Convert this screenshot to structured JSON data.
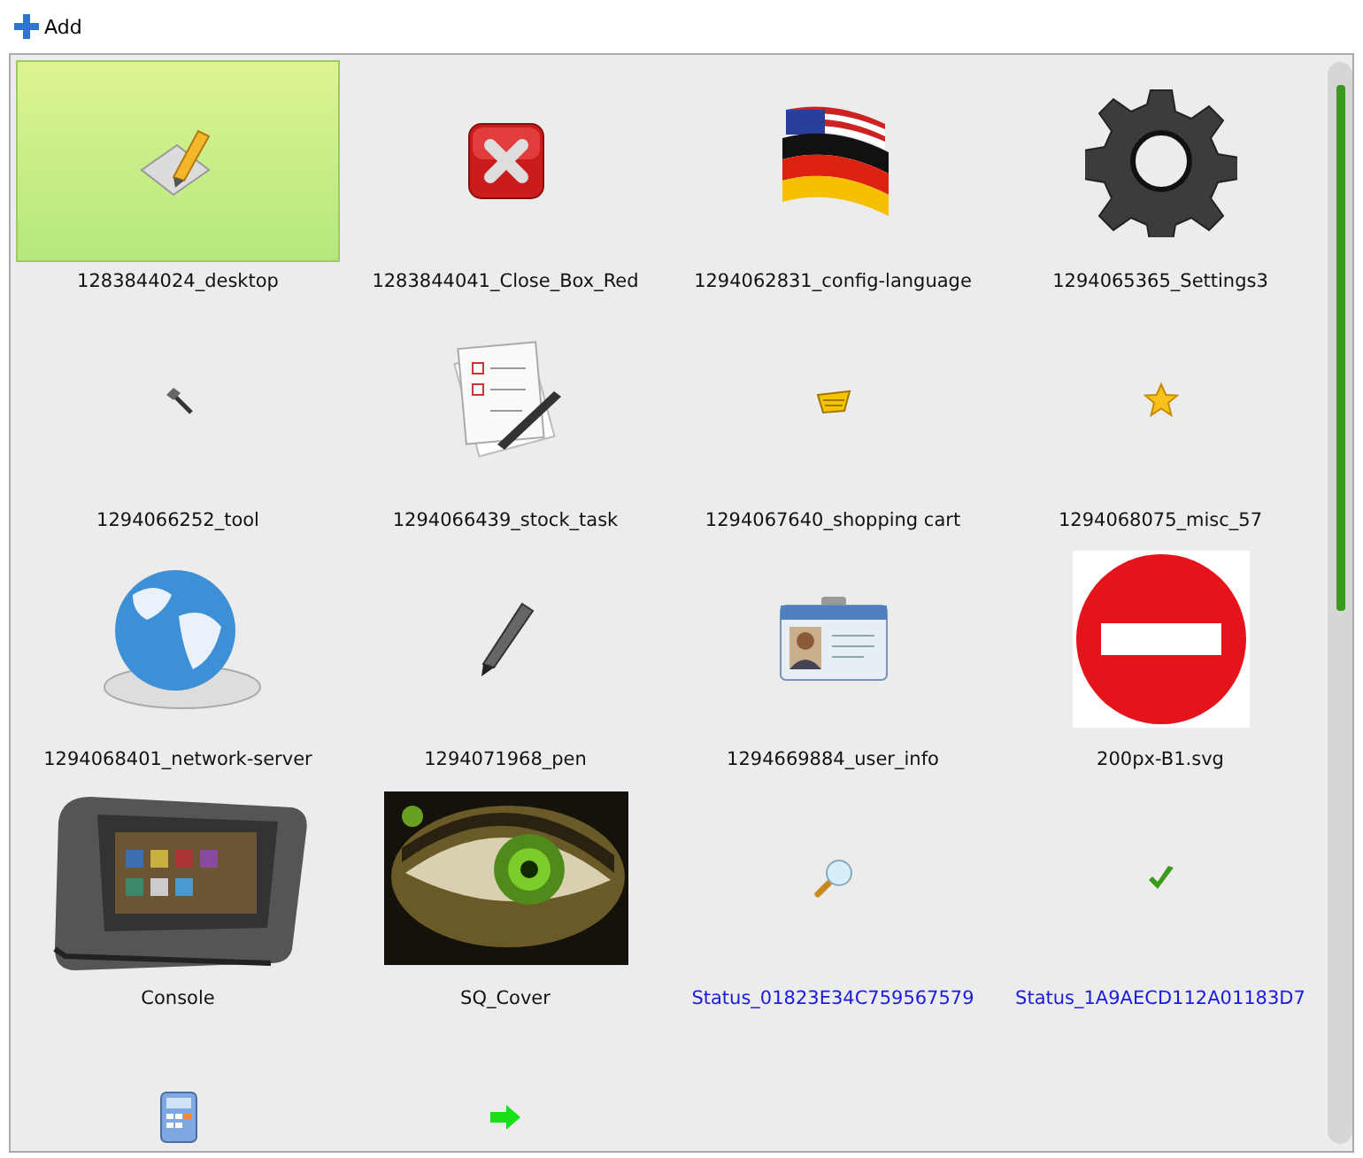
{
  "toolbar": {
    "add_button": "Add"
  },
  "items": [
    {
      "kind": "icon",
      "label": "1283844024_desktop",
      "selected": true
    },
    {
      "kind": "icon",
      "label": "1283844041_Close_Box_Red",
      "selected": false
    },
    {
      "kind": "icon",
      "label": "1294062831_config-language",
      "selected": false
    },
    {
      "kind": "icon",
      "label": "1294065365_Settings3",
      "selected": false
    },
    {
      "kind": "icon",
      "label": "1294066252_tool",
      "selected": false
    },
    {
      "kind": "icon",
      "label": "1294066439_stock_task",
      "selected": false
    },
    {
      "kind": "icon",
      "label": "1294067640_shopping cart",
      "selected": false
    },
    {
      "kind": "icon",
      "label": "1294068075_misc_57",
      "selected": false
    },
    {
      "kind": "icon",
      "label": "1294068401_network-server",
      "selected": false
    },
    {
      "kind": "icon",
      "label": "1294071968_pen",
      "selected": false
    },
    {
      "kind": "icon",
      "label": "1294669884_user_info",
      "selected": false
    },
    {
      "kind": "icon",
      "label": "200px-B1.svg",
      "selected": false
    },
    {
      "kind": "picture",
      "label": "Console",
      "selected": false
    },
    {
      "kind": "picture",
      "label": "SQ_Cover",
      "selected": false
    },
    {
      "kind": "status",
      "label": "Status_01823E34C759567579",
      "selected": false
    },
    {
      "kind": "status",
      "label": "Status_1A9AECD112A01183D7",
      "selected": false
    },
    {
      "kind": "icon",
      "selected": false
    },
    {
      "kind": "icon",
      "selected": false
    }
  ]
}
